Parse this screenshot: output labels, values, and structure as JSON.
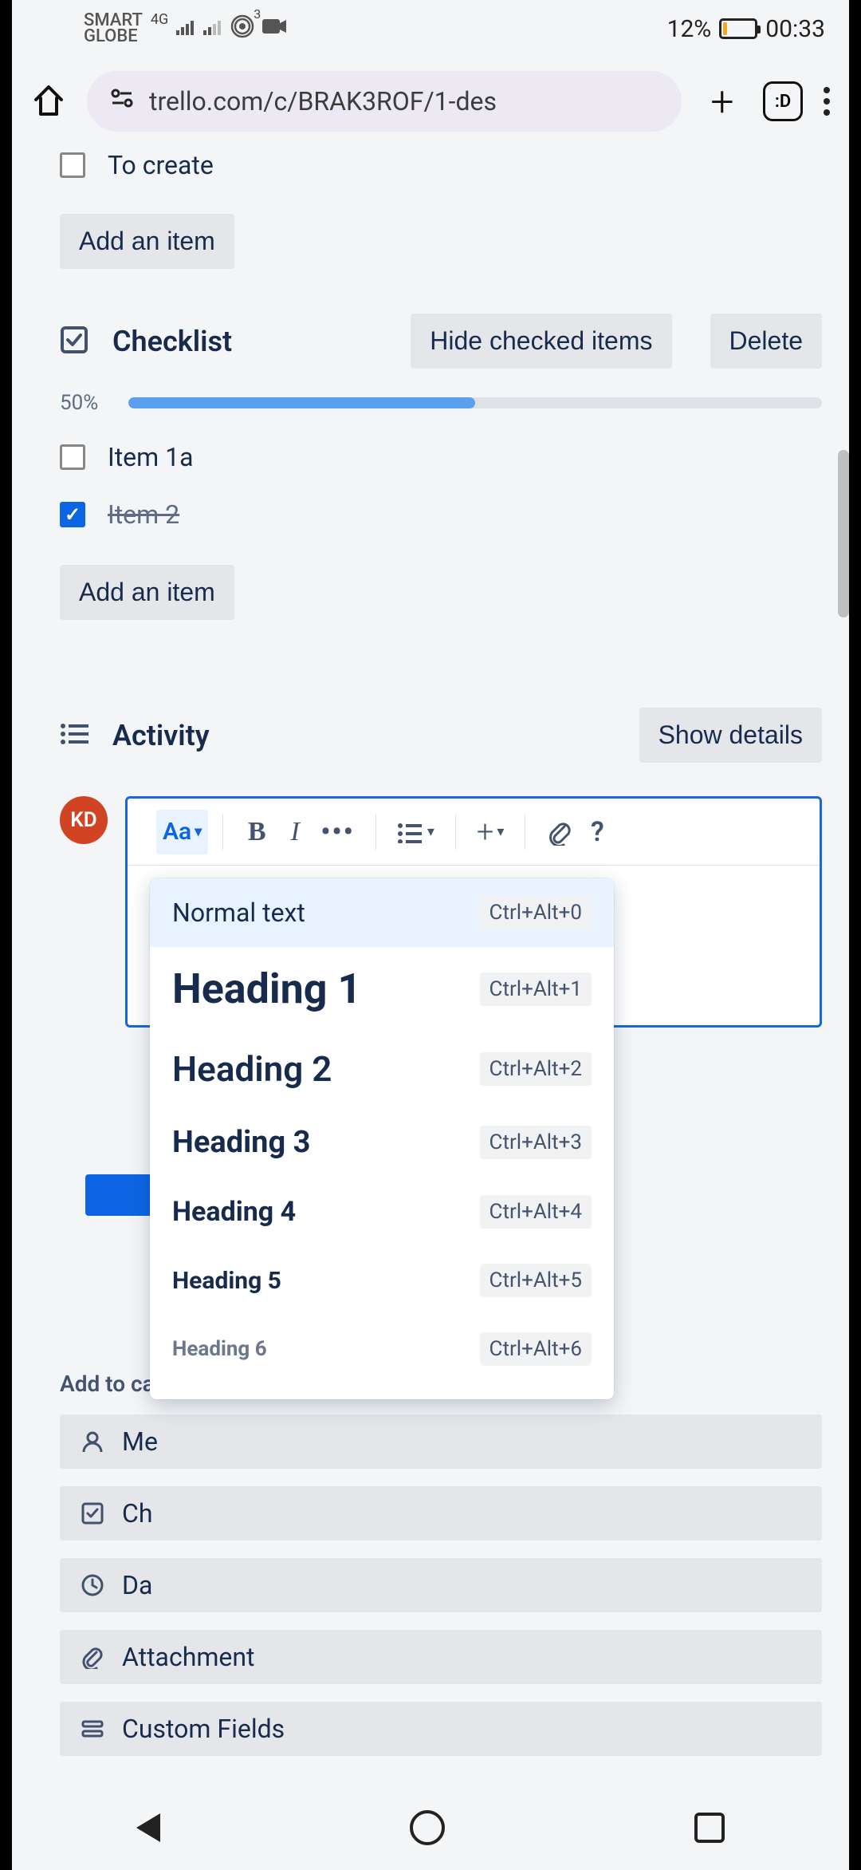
{
  "status": {
    "carrier_line1": "SMART",
    "carrier_line2": "GLOBE",
    "net_badge": "4G",
    "hotspot_count": "3",
    "battery_pct": "12%",
    "time": "00:33"
  },
  "browser": {
    "url": "trello.com/c/BRAK3ROF/1-des",
    "tab_emoji": ":D"
  },
  "top_partial_item": "To create",
  "add_item_label": "Add an item",
  "checklist": {
    "title": "Checklist",
    "hide_label": "Hide checked items",
    "delete_label": "Delete",
    "progress_pct_text": "50%",
    "progress_pct_value": 50,
    "items": [
      {
        "label": "Item 1a",
        "checked": false
      },
      {
        "label": "Item 2",
        "checked": true
      }
    ]
  },
  "activity": {
    "title": "Activity",
    "show_details": "Show details",
    "avatar_initials": "KD"
  },
  "toolbar": {
    "text_style": "Aa",
    "bold": "B",
    "italic": "I",
    "more": "•••",
    "help": "?"
  },
  "text_dropdown": [
    {
      "label": "Normal text",
      "shortcut": "Ctrl+Alt+0",
      "cls": "dd-normal",
      "selected": true
    },
    {
      "label": "Heading 1",
      "shortcut": "Ctrl+Alt+1",
      "cls": "dd-h1"
    },
    {
      "label": "Heading 2",
      "shortcut": "Ctrl+Alt+2",
      "cls": "dd-h2"
    },
    {
      "label": "Heading 3",
      "shortcut": "Ctrl+Alt+3",
      "cls": "dd-h3"
    },
    {
      "label": "Heading 4",
      "shortcut": "Ctrl+Alt+4",
      "cls": "dd-h4"
    },
    {
      "label": "Heading 5",
      "shortcut": "Ctrl+Alt+5",
      "cls": "dd-h5"
    },
    {
      "label": "Heading 6",
      "shortcut": "Ctrl+Alt+6",
      "cls": "dd-h6"
    }
  ],
  "add_to_card": {
    "heading_partial": "Add to ca",
    "members_partial": "Me",
    "checklist_partial": "Ch",
    "dates_partial": "Da",
    "attachment": "Attachment",
    "custom_fields": "Custom Fields"
  }
}
